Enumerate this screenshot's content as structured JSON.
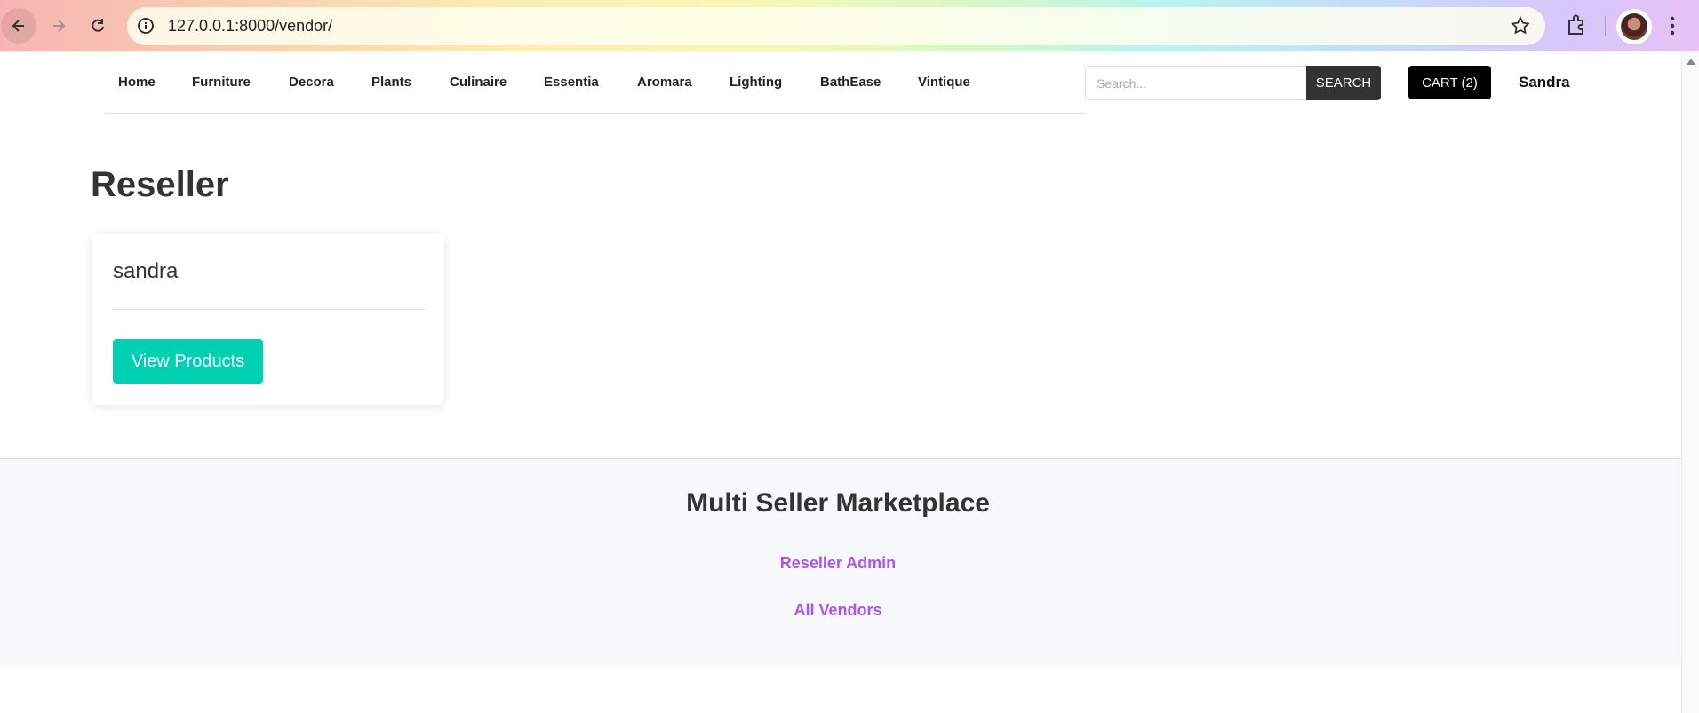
{
  "browser": {
    "url": "127.0.0.1:8000/vendor/",
    "icons": [
      "back-arrow-icon",
      "forward-arrow-icon",
      "reload-icon",
      "site-info-icon",
      "bookmark-star-icon",
      "extensions-puzzle-icon",
      "profile-avatar",
      "kebab-menu-icon"
    ]
  },
  "nav": {
    "items": [
      "Home",
      "Furniture",
      "Decora",
      "Plants",
      "Culinaire",
      "Essentia",
      "Aromara",
      "Lighting",
      "BathEase",
      "Vintique"
    ]
  },
  "search": {
    "placeholder": "Search...",
    "button_label": "SEARCH"
  },
  "cart": {
    "label": "CART (2)"
  },
  "user": {
    "name": "Sandra"
  },
  "main": {
    "title": "Reseller",
    "vendors": [
      {
        "name": "sandra",
        "button_label": "View Products"
      }
    ]
  },
  "footer": {
    "title": "Multi Seller Marketplace",
    "links": [
      "Reseller Admin",
      "All Vendors"
    ]
  },
  "colors": {
    "accent_teal": "#00d1b2",
    "link_purple": "#a855f7",
    "cart_black": "#000000",
    "search_button": "#333333"
  }
}
